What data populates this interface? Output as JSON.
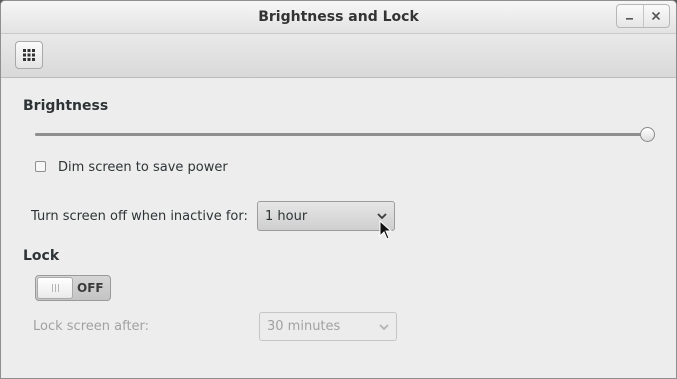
{
  "window": {
    "title": "Brightness and Lock",
    "minimize_glyph": "_",
    "close_glyph": "✕"
  },
  "toolbar": {
    "app_grid_icon": "app-grid-icon"
  },
  "brightness": {
    "label": "Brightness",
    "slider_value": 1.0,
    "dim_checkbox": {
      "label": "Dim screen to save power",
      "checked": false
    },
    "inactive_label": "Turn screen off when inactive for:",
    "inactive_value": "1 hour"
  },
  "lock": {
    "label": "Lock",
    "switch_state": "OFF",
    "after_label": "Lock screen after:",
    "after_value": "30 minutes",
    "after_disabled": true
  },
  "colors": {
    "window_bg": "#ededed",
    "disabled_text": "#a1a1a1"
  }
}
